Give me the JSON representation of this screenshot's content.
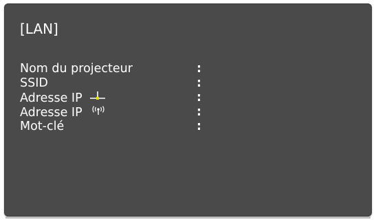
{
  "header": {
    "title": "[LAN]"
  },
  "rows": [
    {
      "label": "Nom du projecteur",
      "separator": ":",
      "icon": ""
    },
    {
      "label": "SSID",
      "separator": ":",
      "icon": ""
    },
    {
      "label": "Adresse IP",
      "separator": ":",
      "icon": "wired-lan-icon"
    },
    {
      "label": "Adresse IP",
      "separator": ":",
      "icon": "wireless-icon"
    },
    {
      "label": "Mot-clé",
      "separator": ":",
      "icon": ""
    }
  ],
  "colors": {
    "panel_background": "#4a4a4a",
    "text": "#ffffff",
    "wired_icon_accent": "#e8e000"
  }
}
